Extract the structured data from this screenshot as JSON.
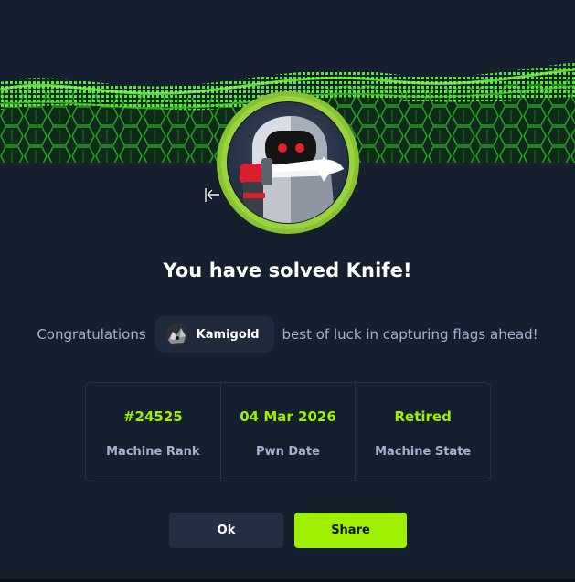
{
  "dialog": {
    "title": "You have solved Knife!",
    "congrats_prefix": "Congratulations",
    "congrats_suffix": "best of luck in capturing flags ahead!",
    "user": {
      "name": "Kamigold",
      "avatar_icon": "user-avatar"
    },
    "machine_icon": "knife-robot-avatar"
  },
  "stats": [
    {
      "value": "#24525",
      "label": "Machine Rank"
    },
    {
      "value": "04 Mar 2026",
      "label": "Pwn Date"
    },
    {
      "value": "Retired",
      "label": "Machine State"
    }
  ],
  "buttons": {
    "ok_label": "Ok",
    "share_label": "Share"
  },
  "colors": {
    "accent": "#9fef00",
    "background": "#151f2e",
    "muted_text": "#a4b1cd",
    "chip_bg": "#1f2b3d",
    "ok_button_bg": "#233043"
  }
}
